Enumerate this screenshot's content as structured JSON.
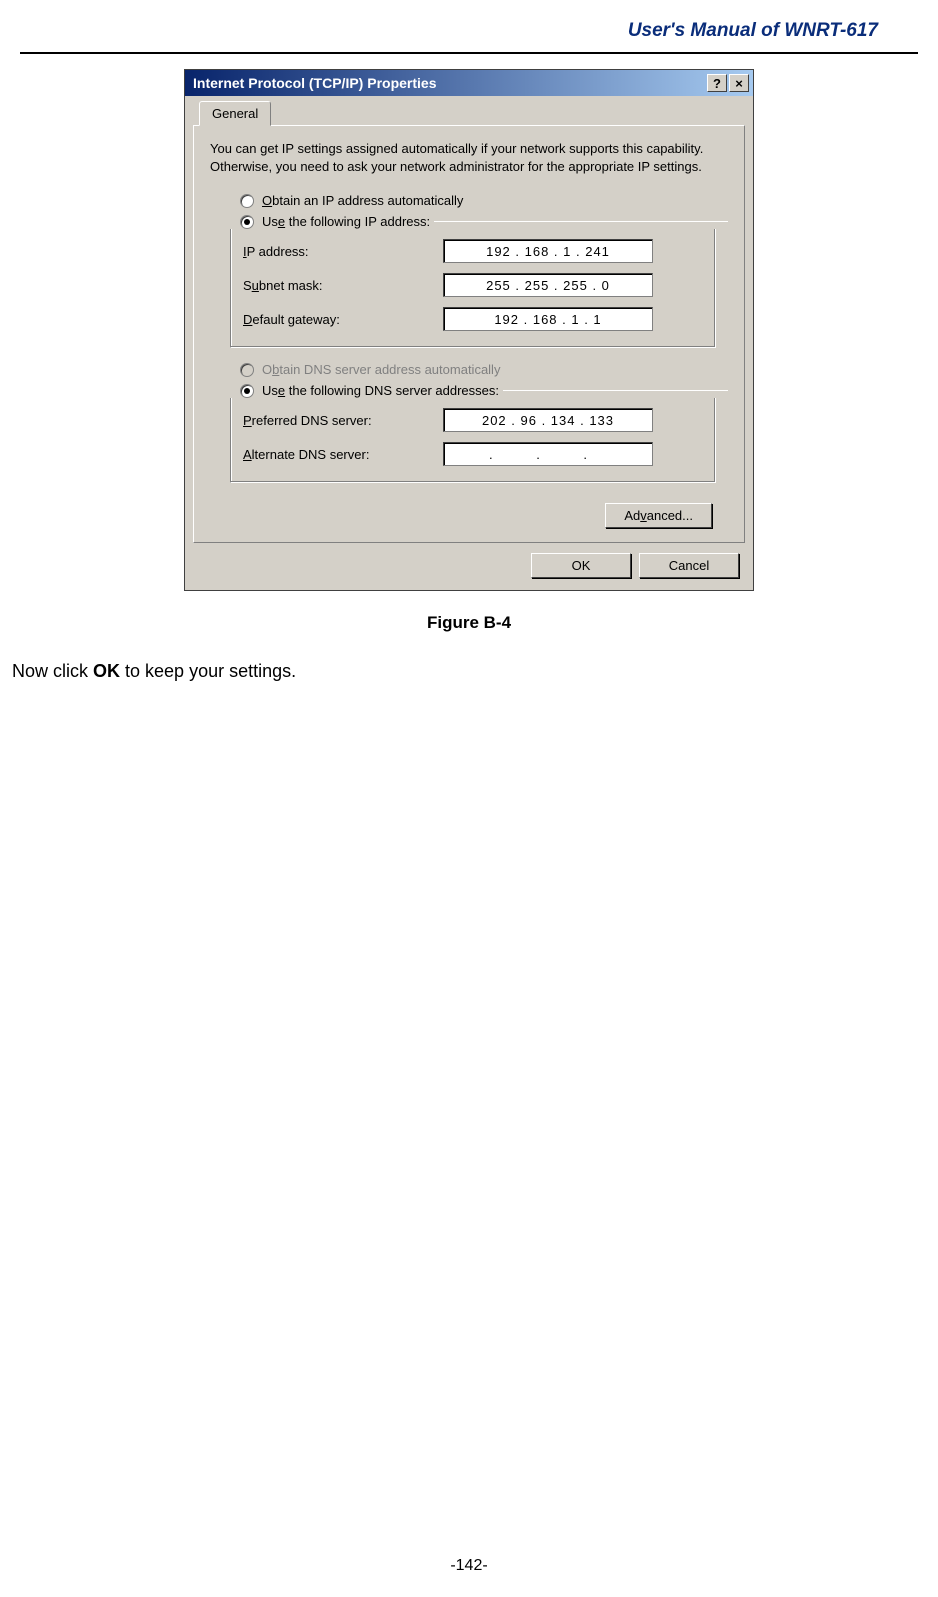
{
  "header": {
    "title": "User's Manual of WNRT-617"
  },
  "dialog": {
    "title": "Internet Protocol (TCP/IP) Properties",
    "help_symbol": "?",
    "close_symbol": "×",
    "tab_general": "General",
    "intro": "You can get IP settings assigned automatically if your network supports this capability. Otherwise, you need to ask your network administrator for the appropriate IP settings.",
    "radio_auto_ip_prefix": "O",
    "radio_auto_ip_suffix": "btain an IP address automatically",
    "radio_use_ip_prefix": "Us",
    "radio_use_ip_suffix": "e the following IP address:",
    "ip_label_prefix": "I",
    "ip_label_suffix": "P address:",
    "ip_value": "192 . 168 .   1   . 241",
    "subnet_label_prefix": "S",
    "subnet_label_suffix": "u",
    "subnet_label_rest": "bnet mask:",
    "subnet_value": "255 . 255 . 255 .   0",
    "gateway_label_prefix": "D",
    "gateway_label_suffix": "efault gateway:",
    "gateway_value": "192 . 168 .   1   .   1",
    "radio_auto_dns_prefix": "O",
    "radio_auto_dns_suffix": "b",
    "radio_auto_dns_rest": "tain DNS server address automatically",
    "radio_use_dns_prefix": "Us",
    "radio_use_dns_suffix": "e",
    "radio_use_dns_rest": " the following DNS server addresses:",
    "pref_dns_label_prefix": "P",
    "pref_dns_label_suffix": "referred DNS server:",
    "pref_dns_value": "202 .  96  . 134 . 133",
    "alt_dns_label_prefix": "A",
    "alt_dns_label_suffix": "lternate DNS server:",
    "alt_dns_value": ".        .        .",
    "advanced_prefix": "Ad",
    "advanced_suffix": "v",
    "advanced_rest": "anced...",
    "ok": "OK",
    "cancel": "Cancel"
  },
  "figure_caption": "Figure B-4",
  "instruction": {
    "prefix": "Now click ",
    "bold": "OK",
    "suffix": " to keep your settings."
  },
  "page_number": "-142-"
}
